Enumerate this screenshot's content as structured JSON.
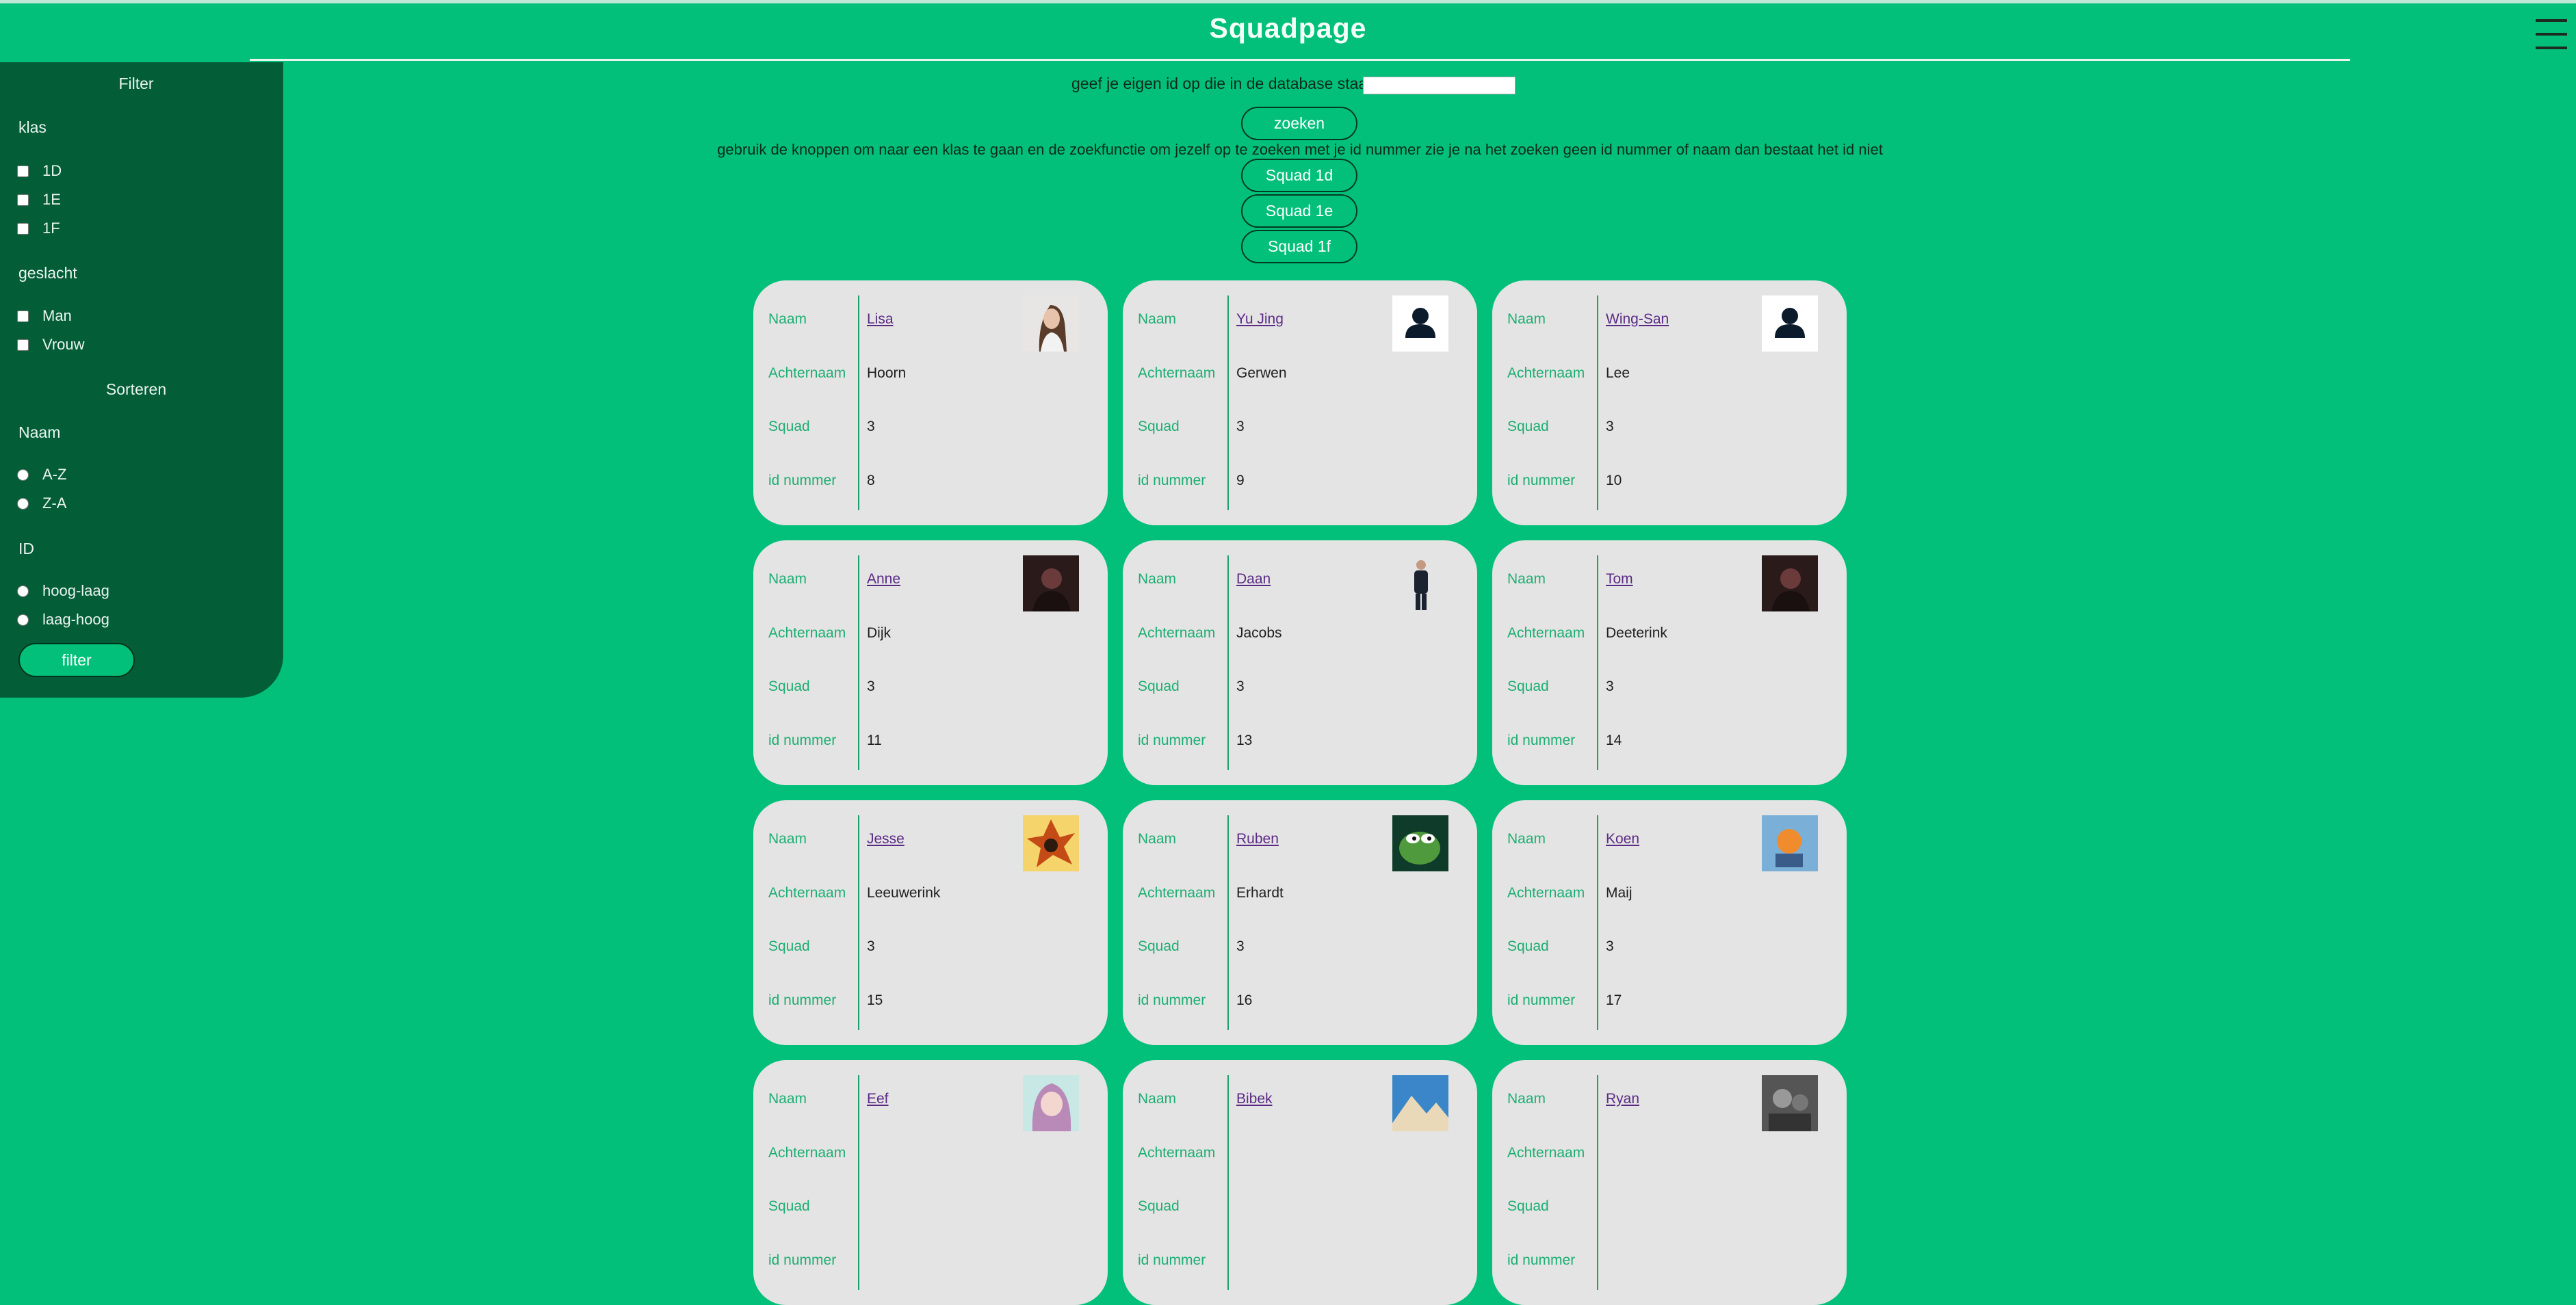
{
  "page": {
    "title": "Squadpage",
    "bg": "#02c07a",
    "sidebar_bg": "#035d37"
  },
  "menu": {
    "icon": "hamburger-menu-icon"
  },
  "search": {
    "prompt": "geef je eigen id op die in de database staat",
    "value": "",
    "button": "zoeken",
    "hint": "gebruik de knoppen om naar een klas te gaan en de zoekfunctie om jezelf op te zoeken met je id nummer zie je na het zoeken geen id nummer of naam dan bestaat het id niet"
  },
  "squads": [
    "Squad 1d",
    "Squad 1e",
    "Squad 1f"
  ],
  "filter": {
    "title": "Filter",
    "klas_label": "klas",
    "klas": [
      "1D",
      "1E",
      "1F"
    ],
    "geslacht_label": "geslacht",
    "geslacht": [
      "Man",
      "Vrouw"
    ],
    "sort_title": "Sorteren",
    "naam_label": "Naam",
    "naam": [
      "A-Z",
      "Z-A"
    ],
    "id_label": "ID",
    "id": [
      "hoog-laag",
      "laag-hoog"
    ],
    "button": "filter"
  },
  "card_labels": {
    "name": "Naam",
    "lastname": "Achternaam",
    "squad": "Squad",
    "id": "id nummer"
  },
  "cards": [
    {
      "name": "Lisa",
      "lastname": "Hoorn",
      "squad": "3",
      "id": "8",
      "photo": "portrait-woman"
    },
    {
      "name": "Yu Jing",
      "lastname": "Gerwen",
      "squad": "3",
      "id": "9",
      "photo": "default-avatar-icon"
    },
    {
      "name": "Wing-San",
      "lastname": "Lee",
      "squad": "3",
      "id": "10",
      "photo": "default-avatar-icon"
    },
    {
      "name": "Anne",
      "lastname": "Dijk",
      "squad": "3",
      "id": "11",
      "photo": "dark-portrait"
    },
    {
      "name": "Daan",
      "lastname": "Jacobs",
      "squad": "3",
      "id": "13",
      "photo": "standing-man"
    },
    {
      "name": "Tom",
      "lastname": "Deeterink",
      "squad": "3",
      "id": "14",
      "photo": "dark-portrait"
    },
    {
      "name": "Jesse",
      "lastname": "Leeuwerink",
      "squad": "3",
      "id": "15",
      "photo": "anime-fire"
    },
    {
      "name": "Ruben",
      "lastname": "Erhardt",
      "squad": "3",
      "id": "16",
      "photo": "frog-meme"
    },
    {
      "name": "Koen",
      "lastname": "Maij",
      "squad": "3",
      "id": "17",
      "photo": "cartoon-art"
    },
    {
      "name": "Eef",
      "lastname": "",
      "squad": "",
      "id": "",
      "photo": "anime-girl"
    },
    {
      "name": "Bibek",
      "lastname": "",
      "squad": "",
      "id": "",
      "photo": "mountain-scene"
    },
    {
      "name": "Ryan",
      "lastname": "",
      "squad": "",
      "id": "",
      "photo": "bw-photo"
    }
  ]
}
